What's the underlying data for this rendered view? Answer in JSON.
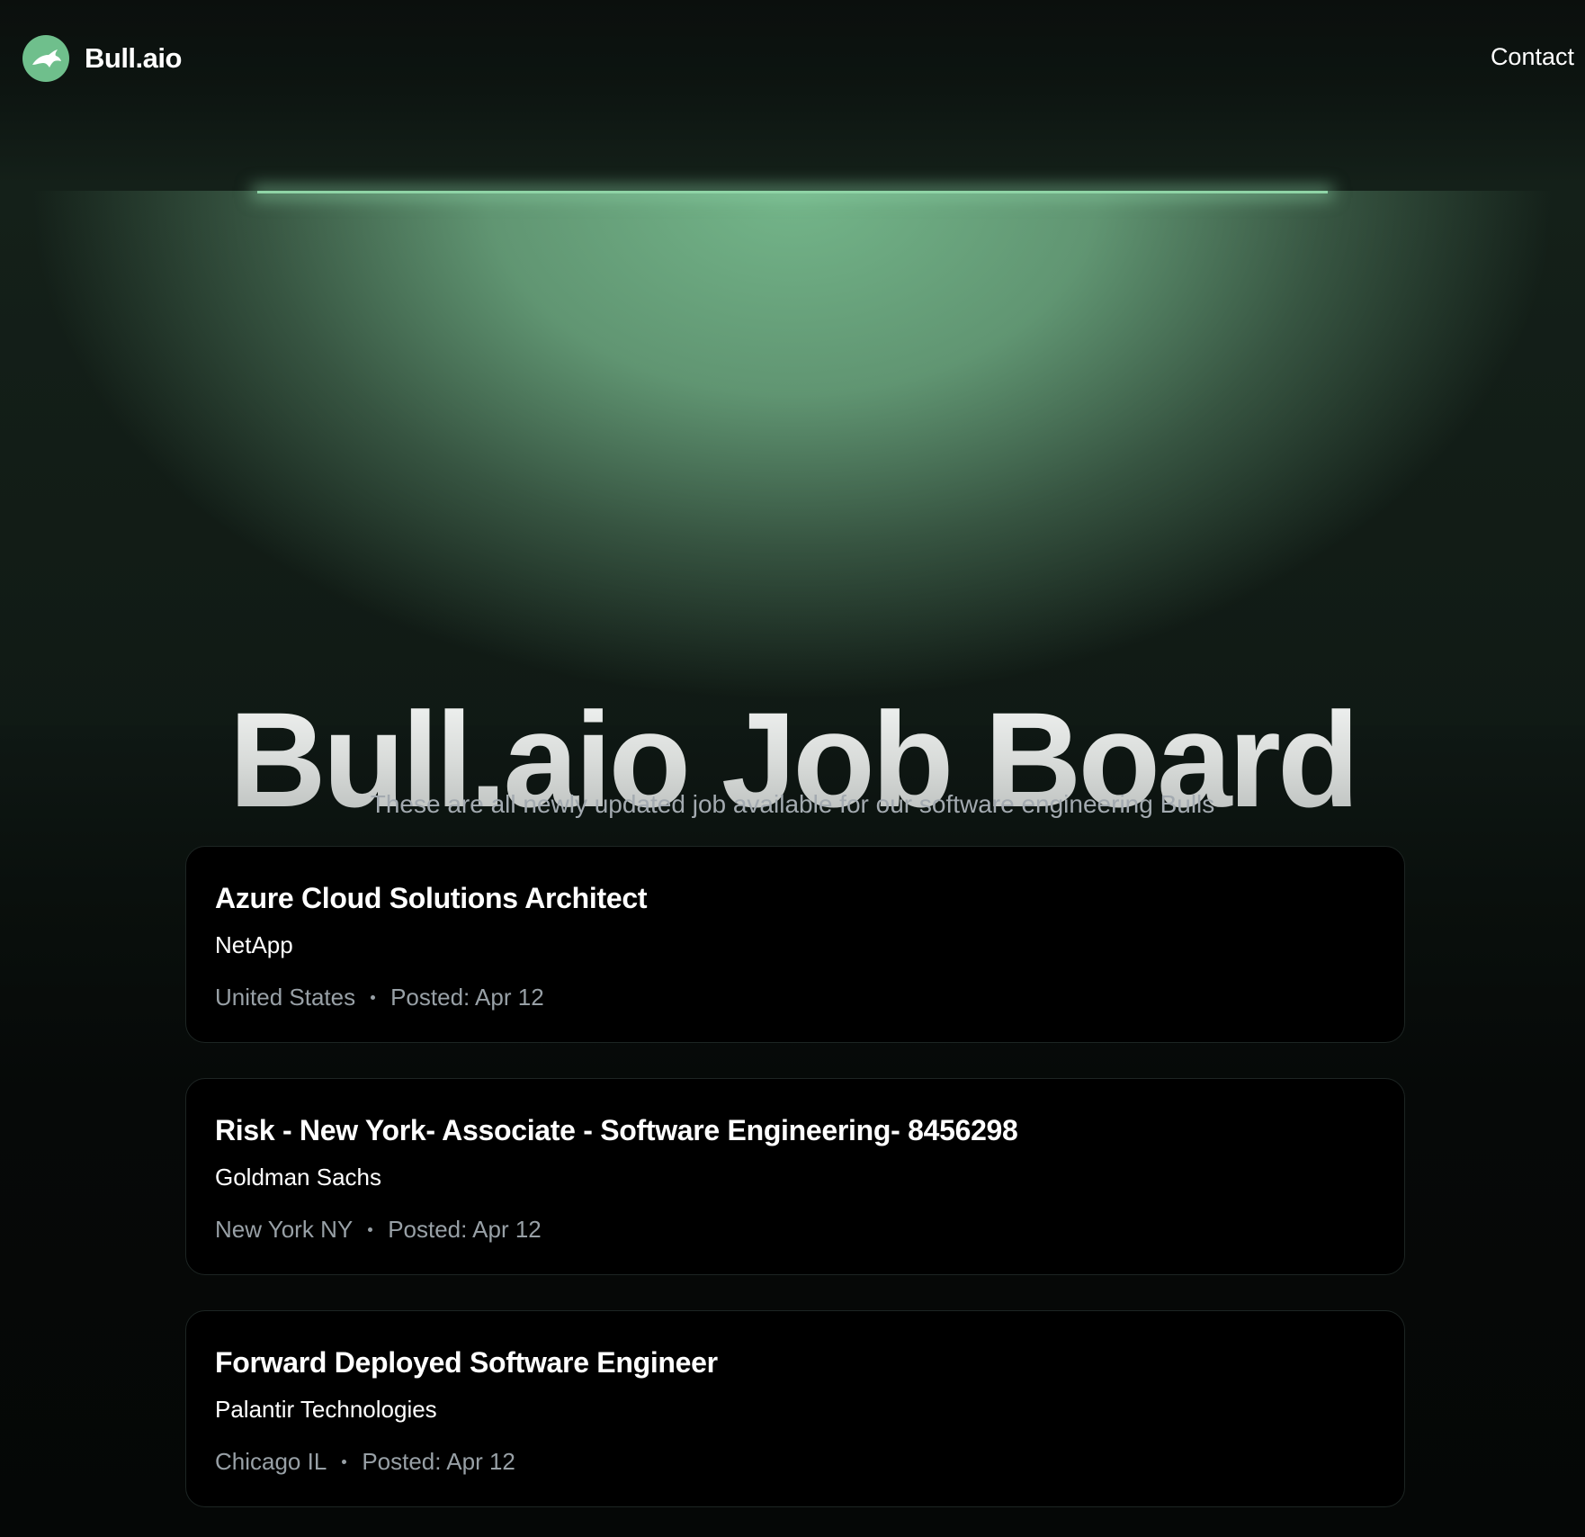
{
  "nav": {
    "brand": "Bull.aio",
    "contact_label": "Contact",
    "logo_icon": "bull-icon"
  },
  "hero": {
    "title": "Bull.aio Job Board",
    "subtitle": "These are all newly updated job available for our software engineering Bulls"
  },
  "colors": {
    "accent": "#6fbf8c",
    "background": "#050807",
    "card": "#000000",
    "muted_text": "#98a0a6"
  },
  "jobs": [
    {
      "title": "Azure Cloud Solutions Architect",
      "company": "NetApp",
      "location": "United States",
      "posted": "Posted: Apr 12"
    },
    {
      "title": "Risk - New York- Associate - Software Engineering- 8456298",
      "company": "Goldman Sachs",
      "location": "New York NY",
      "posted": "Posted: Apr 12"
    },
    {
      "title": "Forward Deployed Software Engineer",
      "company": "Palantir Technologies",
      "location": "Chicago IL",
      "posted": "Posted: Apr 12"
    }
  ]
}
